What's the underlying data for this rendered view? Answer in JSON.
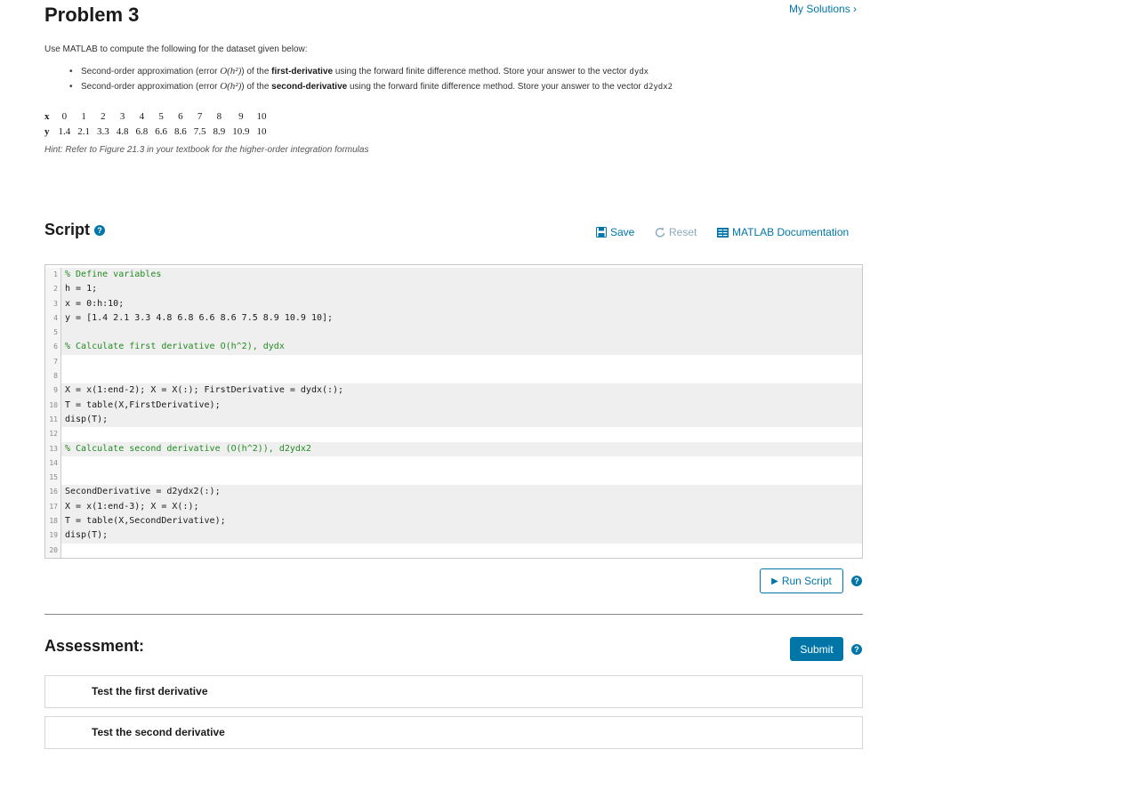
{
  "page_title": "Problem 3",
  "my_solutions": "My Solutions ›",
  "intro": "Use MATLAB to compute the following for the dataset given below:",
  "bullets": [
    {
      "prefix": "Second-order approximation (error ",
      "math": "O(h²)",
      "mid": ") of the ",
      "bold": "first-derivative",
      "suffix": " using the forward finite difference method. Store your answer to the vector ",
      "var": "dydx"
    },
    {
      "prefix": "Second-order approximation (error ",
      "math": "O(h²)",
      "mid": ") of the ",
      "bold": "second-derivative",
      "suffix": " using the forward finite difference method. Store your answer to the vector ",
      "var": "d2ydx2"
    }
  ],
  "table": {
    "x_label": "x",
    "y_label": "y",
    "x": [
      "0",
      "1",
      "2",
      "3",
      "4",
      "5",
      "6",
      "7",
      "8",
      "9",
      "10"
    ],
    "y": [
      "1.4",
      "2.1",
      "3.3",
      "4.8",
      "6.8",
      "6.6",
      "8.6",
      "7.5",
      "8.9",
      "10.9",
      "10"
    ]
  },
  "hint": "Hint: Refer to Figure 21.3 in your textbook for the higher-order integration formulas",
  "script": {
    "title": "Script",
    "save": "Save",
    "reset": "Reset",
    "docs": "MATLAB Documentation",
    "lines": [
      {
        "n": "1",
        "text": "% Define variables",
        "comment": true,
        "shaded": true
      },
      {
        "n": "2",
        "text": "h = 1;",
        "comment": false,
        "shaded": true
      },
      {
        "n": "3",
        "text": "x = 0:h:10;",
        "comment": false,
        "shaded": true
      },
      {
        "n": "4",
        "text": "y = [1.4 2.1 3.3 4.8 6.8 6.6 8.6 7.5 8.9 10.9 10];",
        "comment": false,
        "shaded": true
      },
      {
        "n": "5",
        "text": "",
        "comment": false,
        "shaded": true
      },
      {
        "n": "6",
        "text": "% Calculate first derivative O(h^2), dydx",
        "comment": true,
        "shaded": true
      },
      {
        "n": "7",
        "text": "",
        "comment": false,
        "shaded": false
      },
      {
        "n": "8",
        "text": "",
        "comment": false,
        "shaded": false
      },
      {
        "n": "9",
        "text": "X = x(1:end-2); X = X(:); FirstDerivative = dydx(:);",
        "comment": false,
        "shaded": true
      },
      {
        "n": "10",
        "text": "T = table(X,FirstDerivative);",
        "comment": false,
        "shaded": true
      },
      {
        "n": "11",
        "text": "disp(T);",
        "comment": false,
        "shaded": true
      },
      {
        "n": "12",
        "text": "",
        "comment": false,
        "shaded": false
      },
      {
        "n": "13",
        "text": "% Calculate second derivative (O(h^2)), d2ydx2",
        "comment": true,
        "shaded": true
      },
      {
        "n": "14",
        "text": "",
        "comment": false,
        "shaded": false
      },
      {
        "n": "15",
        "text": "",
        "comment": false,
        "shaded": false
      },
      {
        "n": "16",
        "text": "SecondDerivative = d2ydx2(:);",
        "comment": false,
        "shaded": true
      },
      {
        "n": "17",
        "text": "X = x(1:end-3); X = X(:);",
        "comment": false,
        "shaded": true
      },
      {
        "n": "18",
        "text": "T = table(X,SecondDerivative);",
        "comment": false,
        "shaded": true
      },
      {
        "n": "19",
        "text": "disp(T);",
        "comment": false,
        "shaded": true
      },
      {
        "n": "20",
        "text": "",
        "comment": false,
        "shaded": false
      }
    ],
    "run_label": "Run Script"
  },
  "assessment": {
    "title": "Assessment:",
    "submit": "Submit",
    "tests": [
      "Test the first derivative",
      "Test the second derivative"
    ]
  },
  "colors": {
    "accent": "#0076a8",
    "comment": "#228b22",
    "reset_disabled": "#8aaabd"
  }
}
